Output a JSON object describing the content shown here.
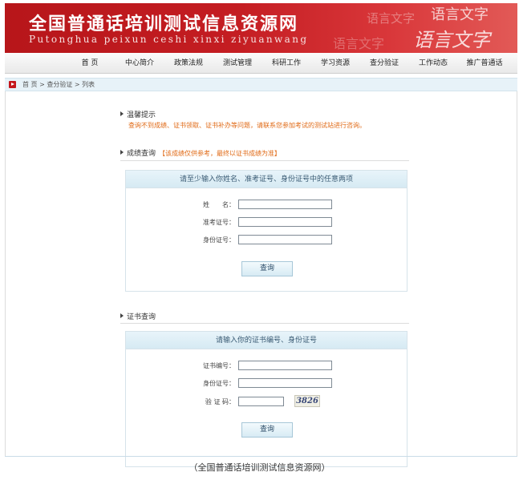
{
  "banner": {
    "title": "全国普通话培训测试信息资源网",
    "subtitle": "Putonghua peixun ceshi xinxi ziyuanwang",
    "decor_text": [
      "语言文字",
      "语言文字",
      "语言文字",
      "语言文字"
    ]
  },
  "nav": {
    "items": [
      "首 页",
      "中心简介",
      "政策法规",
      "测试管理",
      "科研工作",
      "学习资源",
      "查分验证",
      "工作动态",
      "推广普通话"
    ]
  },
  "breadcrumb": {
    "home": "首 页",
    "sep1": " > ",
    "level1": "查分验证",
    "sep2": " > ",
    "level2": "列表"
  },
  "tips": {
    "heading": "温馨提示",
    "text": "查询不到成绩、证书领取、证书补办等问题，请联系您参加考试的测试站进行咨询。"
  },
  "score_query": {
    "heading": "成绩查询",
    "note": "【该成绩仅供参考，最终以证书成绩为准】",
    "panel_title": "请至少输入你姓名、准考证号、身份证号中的任意两项",
    "fields": [
      {
        "label": "姓　　名：",
        "value": ""
      },
      {
        "label": "准考证号：",
        "value": ""
      },
      {
        "label": "身份证号：",
        "value": ""
      }
    ],
    "button": "查询"
  },
  "cert_query": {
    "heading": "证书查询",
    "panel_title": "请输入你的证书编号、身份证号",
    "fields": [
      {
        "label": "证书编号：",
        "value": ""
      },
      {
        "label": "身份证号：",
        "value": ""
      },
      {
        "label": "验 证 码：",
        "value": ""
      }
    ],
    "captcha": "3826",
    "button": "查询"
  },
  "caption": "（全国普通话培训测试信息资源网）",
  "colors": {
    "banner_red": "#c41d22",
    "tip_orange": "#e06a16",
    "panel_header": "#d6eaf3"
  }
}
